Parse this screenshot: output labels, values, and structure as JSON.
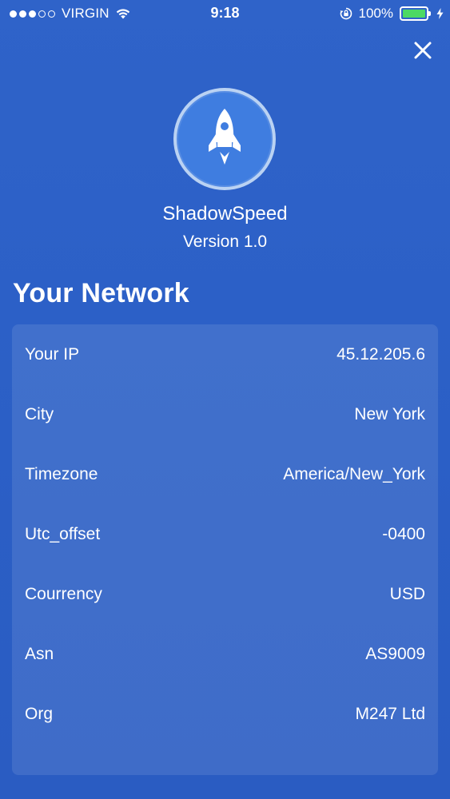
{
  "status_bar": {
    "carrier": "VIRGIN",
    "time": "9:18",
    "battery_text": "100%",
    "battery_level": 1.0,
    "signal_bars_filled": 3,
    "signal_bars_total": 5,
    "icons": [
      "signal-dots-icon",
      "wifi-icon",
      "rotation-lock-icon",
      "battery-icon",
      "charging-bolt-icon"
    ],
    "battery_color": "#4cd964"
  },
  "header": {
    "close_icon": "close-icon",
    "logo_icon": "rocket-icon",
    "app_name": "ShadowSpeed",
    "version": "Version 1.0"
  },
  "network": {
    "title": "Your Network",
    "rows": [
      {
        "label": "Your IP",
        "value": "45.12.205.6"
      },
      {
        "label": "City",
        "value": "New York"
      },
      {
        "label": "Timezone",
        "value": "America/New_York"
      },
      {
        "label": "Utc_offset",
        "value": "-0400"
      },
      {
        "label": "Courrency",
        "value": "USD"
      },
      {
        "label": "Asn",
        "value": "AS9009"
      },
      {
        "label": "Org",
        "value": "M247 Ltd"
      }
    ]
  },
  "colors": {
    "background": "#2d60c7",
    "logo_fill": "#3f7de0",
    "text": "#ffffff"
  }
}
